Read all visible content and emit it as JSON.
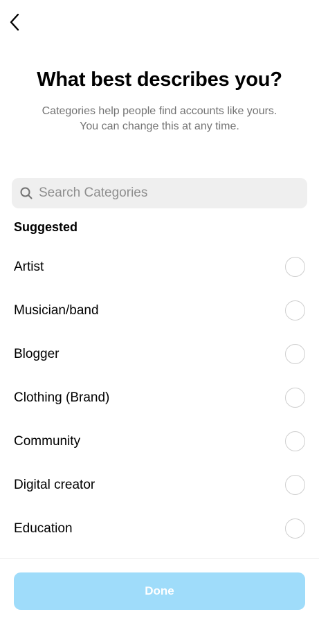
{
  "header": {
    "back_icon": "chevron-left-icon",
    "title": "What best describes you?",
    "subtitle_line1": "Categories help people find accounts like yours.",
    "subtitle_line2": "You can change this at any time."
  },
  "search": {
    "icon": "search-icon",
    "placeholder": "Search Categories",
    "value": ""
  },
  "suggested": {
    "title": "Suggested",
    "items": [
      {
        "label": "Artist",
        "selected": false
      },
      {
        "label": "Musician/band",
        "selected": false
      },
      {
        "label": "Blogger",
        "selected": false
      },
      {
        "label": "Clothing (Brand)",
        "selected": false
      },
      {
        "label": "Community",
        "selected": false
      },
      {
        "label": "Digital creator",
        "selected": false
      },
      {
        "label": "Education",
        "selected": false
      }
    ]
  },
  "footer": {
    "done_label": "Done",
    "done_enabled": false
  },
  "colors": {
    "done_disabled_bg": "#9fdcfa",
    "search_bg": "#efefef",
    "subtitle_text": "#737373",
    "placeholder_text": "#8e8e8e",
    "radio_border": "#cfcfcf"
  }
}
